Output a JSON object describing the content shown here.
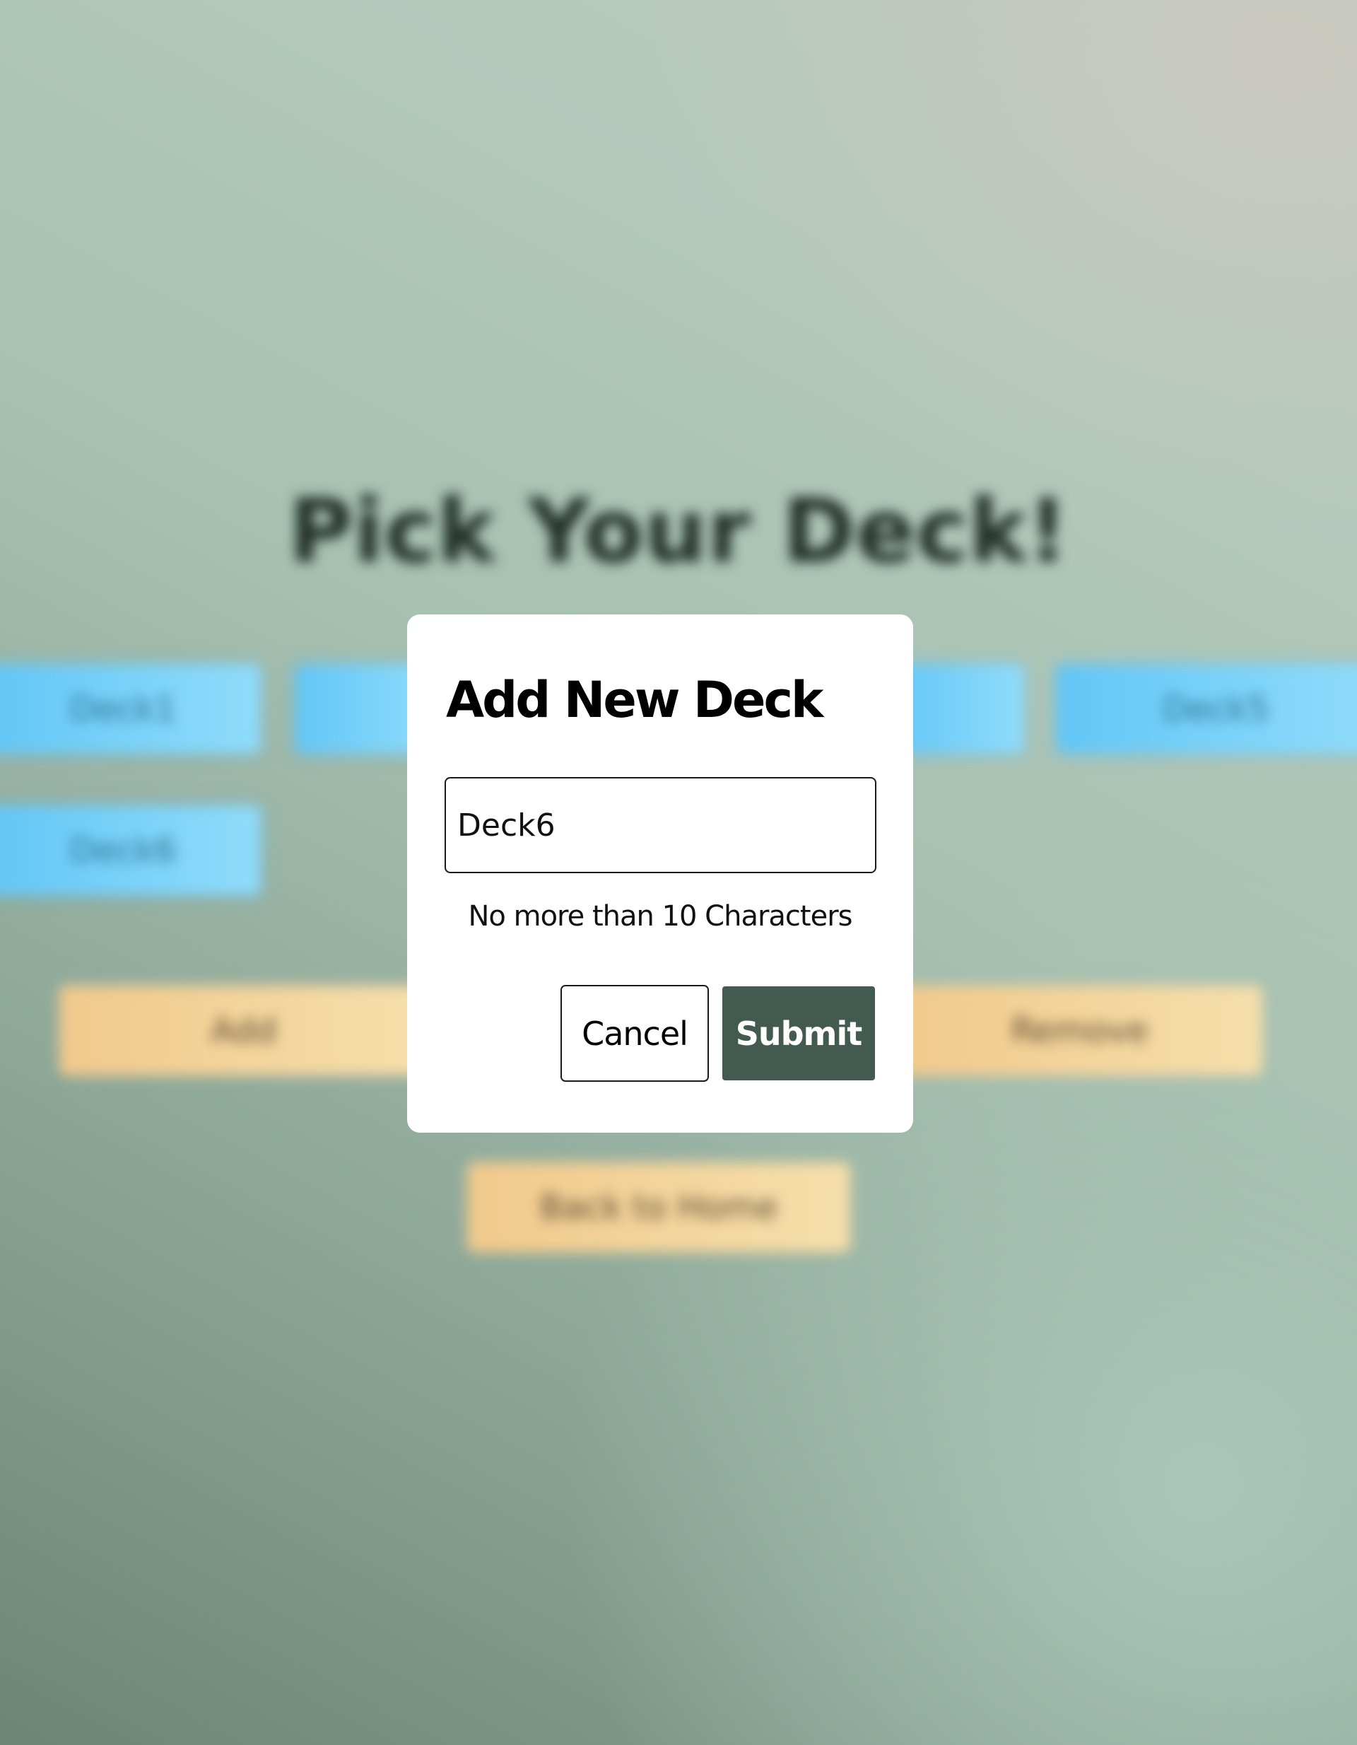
{
  "background": {
    "title": "Pick Your Deck!",
    "deck_buttons": [
      "Deck1",
      "Deck5",
      "Deck6"
    ],
    "add_label": "Add",
    "remove_label": "Remove",
    "back_label": "Back to Home"
  },
  "modal": {
    "title": "Add New Deck",
    "input_value": "Deck6",
    "hint": "No more than 10 Characters",
    "cancel_label": "Cancel",
    "submit_label": "Submit"
  },
  "colors": {
    "submit": "#435a51",
    "deck_button": "#7dd3f8",
    "action_button": "#f3d49c"
  }
}
